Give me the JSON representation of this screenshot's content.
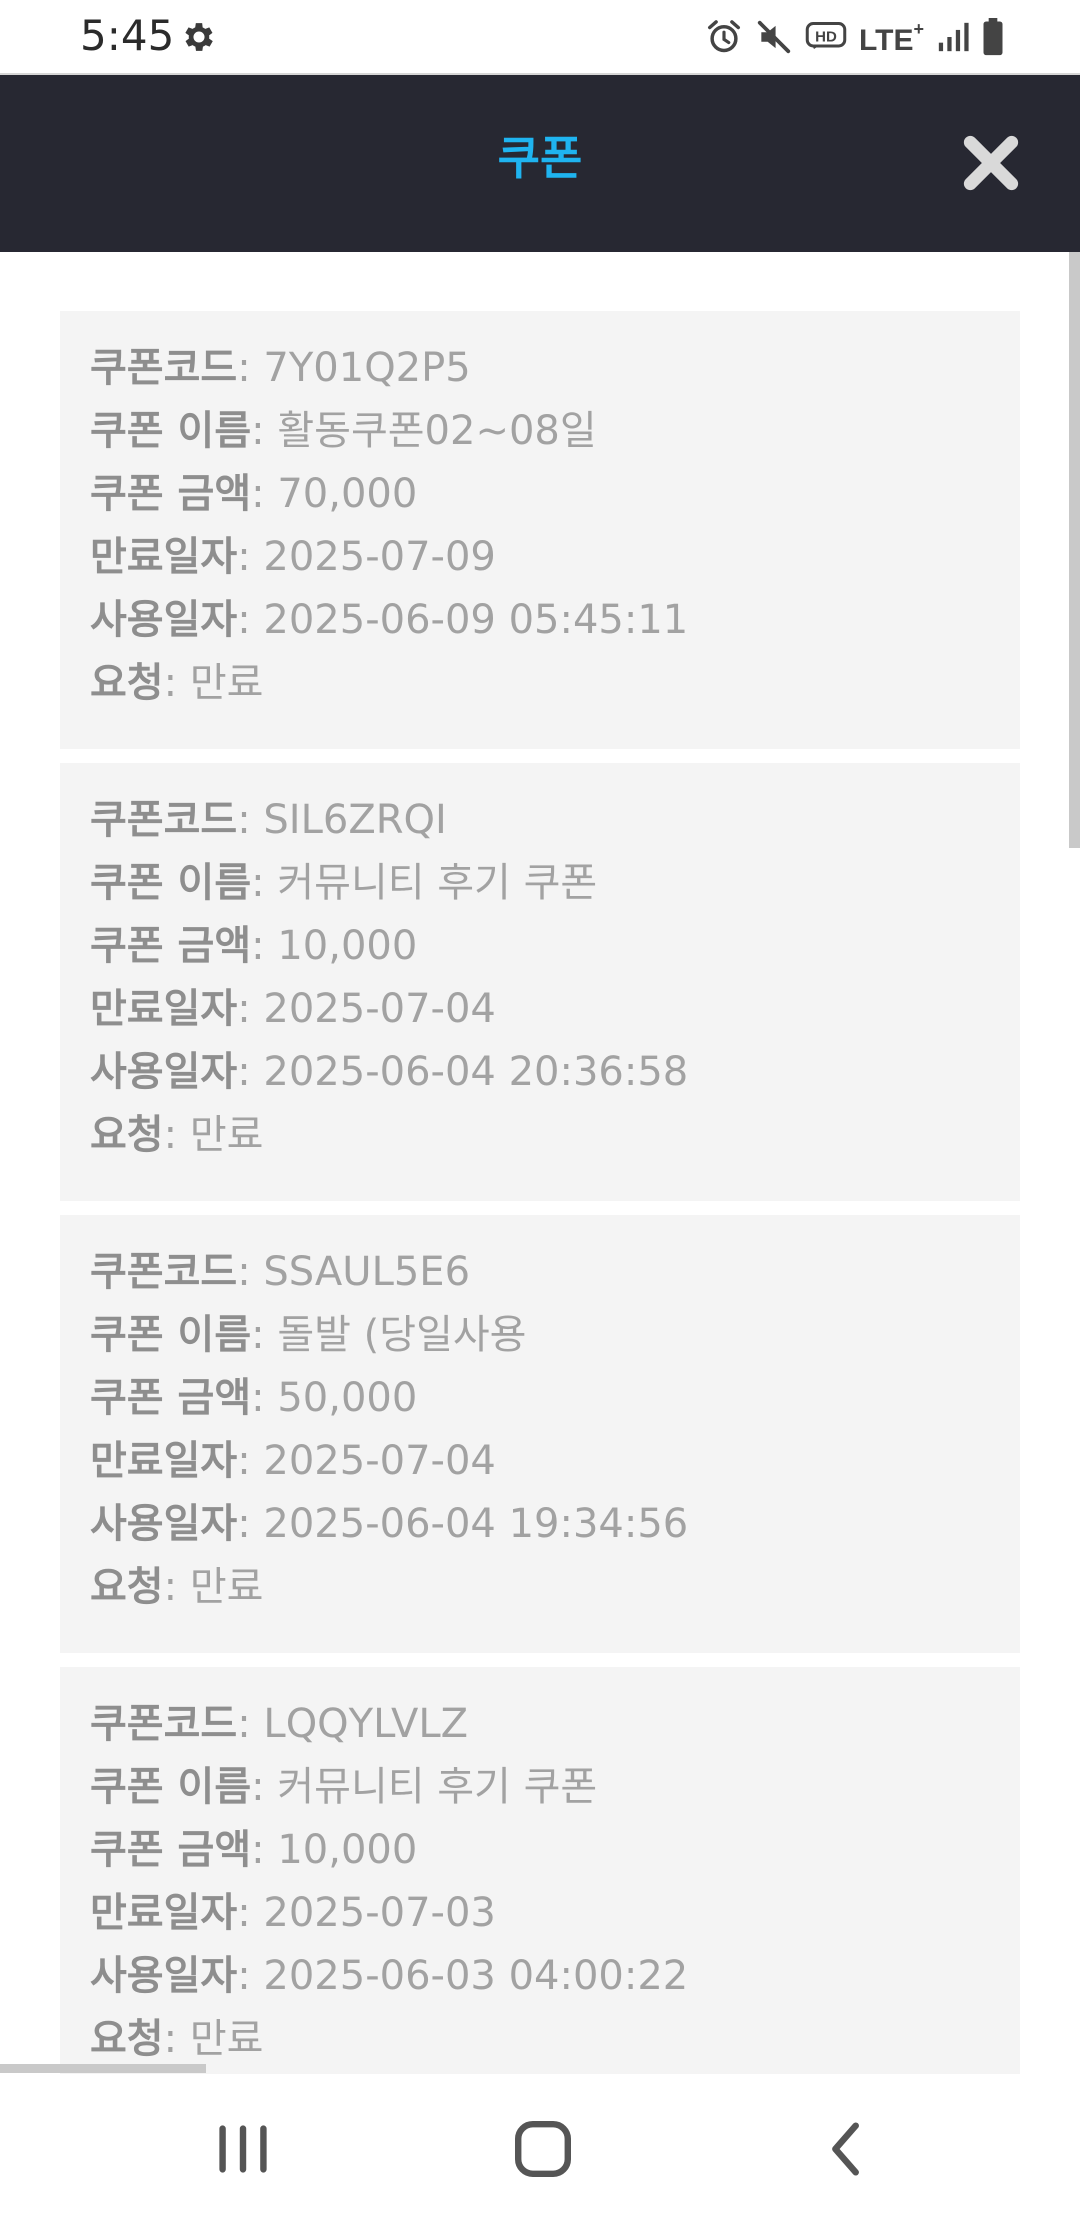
{
  "status_bar": {
    "time": "5:45",
    "left_icons": [
      "gear-icon"
    ],
    "right_icons": [
      "alarm-icon",
      "mute-icon",
      "hd-icon",
      "lte-plus-icon",
      "signal-icon",
      "battery-icon"
    ],
    "lte_label": "LTE",
    "lte_plus": "+",
    "hd_label": "HD"
  },
  "header": {
    "title": "쿠폰",
    "close_icon": "close-icon",
    "background": "#272832",
    "title_color": "#1fb4f0"
  },
  "labels": {
    "code": "쿠폰코드",
    "name": "쿠폰 이름",
    "amount": "쿠폰 금액",
    "expiry": "만료일자",
    "used": "사용일자",
    "request": "요청"
  },
  "coupons": [
    {
      "code": "7Y01Q2P5",
      "name": "활동쿠폰02~08일",
      "amount": "70,000",
      "expiry": "2025-07-09",
      "used": "2025-06-09 05:45:11",
      "request": "만료"
    },
    {
      "code": "SIL6ZRQI",
      "name": "커뮤니티 후기 쿠폰",
      "amount": "10,000",
      "expiry": "2025-07-04",
      "used": "2025-06-04 20:36:58",
      "request": "만료"
    },
    {
      "code": "SSAUL5E6",
      "name": "돌발 (당일사용",
      "amount": "50,000",
      "expiry": "2025-07-04",
      "used": "2025-06-04 19:34:56",
      "request": "만료"
    },
    {
      "code": "LQQYLVLZ",
      "name": "커뮤니티 후기 쿠폰",
      "amount": "10,000",
      "expiry": "2025-07-03",
      "used": "2025-06-03 04:00:22",
      "request": "만료"
    }
  ],
  "nav_bar": {
    "icons": [
      "recent-apps-icon",
      "home-icon",
      "back-icon"
    ]
  }
}
